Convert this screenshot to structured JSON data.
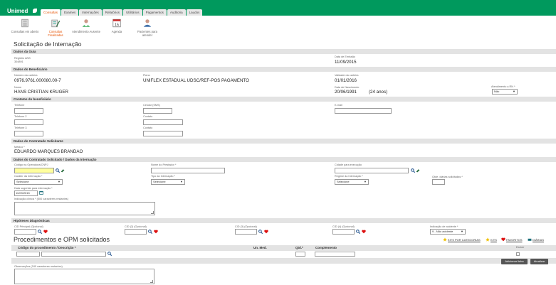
{
  "header": {
    "logo_text": "Unimed",
    "tabs": [
      "Consultas",
      "Exames",
      "Internações",
      "Relatórios",
      "Utilitários",
      "Pagamentos",
      "Auditoria",
      "Laudos"
    ],
    "active_tab": 0,
    "brand_color": "#00995d",
    "accent_color": "#e65100"
  },
  "quick": [
    {
      "label": "Consultas em aberto",
      "icon": "document-list-icon"
    },
    {
      "label": "Consultas Finalizadas",
      "icon": "checklist-pencil-icon"
    },
    {
      "label": "Atendimento Ausente",
      "icon": "doctor-icon"
    },
    {
      "label": "Agenda",
      "icon": "calendar-icon",
      "day": "15"
    },
    {
      "label": "Pacientes para atender",
      "icon": "patient-icon"
    }
  ],
  "page_title": "Solicitação de Internação",
  "guia": {
    "section": "Dados da Guia",
    "registro_ans_label": "Registro ANS",
    "registro_ans": "304891",
    "data_emissao_label": "Data de Emissão",
    "data_emissao": "11/09/2015"
  },
  "beneficiario": {
    "section": "Dados do Beneficiário",
    "numero_label": "Número da carteira",
    "numero": "0976.9761.000080.00-7",
    "plano_label": "Plano",
    "plano": "UNIFLEX ESTADUAL UDSC/REF-POS PAGAMENTO",
    "validade_label": "Validade da carteira",
    "validade": "01/01/2016",
    "nome_label": "Nome",
    "nome": "HANS CRISTIAN KRUGER",
    "nascimento_label": "Data de Nascimento",
    "nascimento": "20/06/1991",
    "idade": "(24 anos)",
    "rn_label": "Atendimento a RN *",
    "rn_value": "Não"
  },
  "contatos": {
    "section": "Contatos do beneficiário",
    "telefone_label": "Telefone",
    "celular_label": "Celular (SMS)",
    "email_label": "E-mail",
    "telefone2_label": "Telefone 2",
    "contato_label": "Contato",
    "telefone3_label": "Telefone 3",
    "contato2_label": "Contato"
  },
  "contratado": {
    "section": "Dados do Contratado Solicitante",
    "medico_label": "Médico *",
    "medico": "EDUARDO MARQUES BRANDAO"
  },
  "internacao": {
    "section": "Dados do Contratado Solicitado / Dados da Internação",
    "codigo_label": "Código na Operadora/CNPJ",
    "nome_prestador_label": "Nome do Prestador *",
    "cidade_label": "Cidade para execução",
    "carater_label": "Caráter da Internação *",
    "carater_value": "Selecione",
    "tipo_label": "Tipo da Internação *",
    "tipo_value": "Selecione",
    "regime_label": "Regime da Internação *",
    "regime_value": "Selecione",
    "diarias_label": "Qtde. diárias solicitadas *",
    "data_sugerida_label": "Data sugerida para internação *",
    "data_sugerida": "11/09/2015",
    "indicacao_label": "Indicação clínica * (500 caracteres restantes)"
  },
  "hipoteses": {
    "section": "Hipóteses Diagnósticas",
    "cid_principal": "CID Principal (Opcional)",
    "cid2": "CID (2) (Opcional)",
    "cid3": "CID (3) (Opcional)",
    "cid4": "CID (4) (Opcional)",
    "acidente_label": "Indicação de acidente *",
    "acidente_value": "9 - Não acidente"
  },
  "procedimentos": {
    "title": "Procedimentos e OPM solicitados",
    "links": [
      "KITS POR CATEGORIAS",
      "KITS",
      "FAVORITOS",
      "DIÁRIAS"
    ],
    "col_codigo": "Código do procedimento / Descrição *",
    "col_un": "Un. Med.",
    "col_qtd": "Qtd.*",
    "col_compl": "Complemento",
    "col_excluir": "Excluir",
    "btn_add": "Adicionar linha",
    "btn_update": "Atualizar",
    "obs_label": "Observações (240 caracteres restantes)"
  }
}
